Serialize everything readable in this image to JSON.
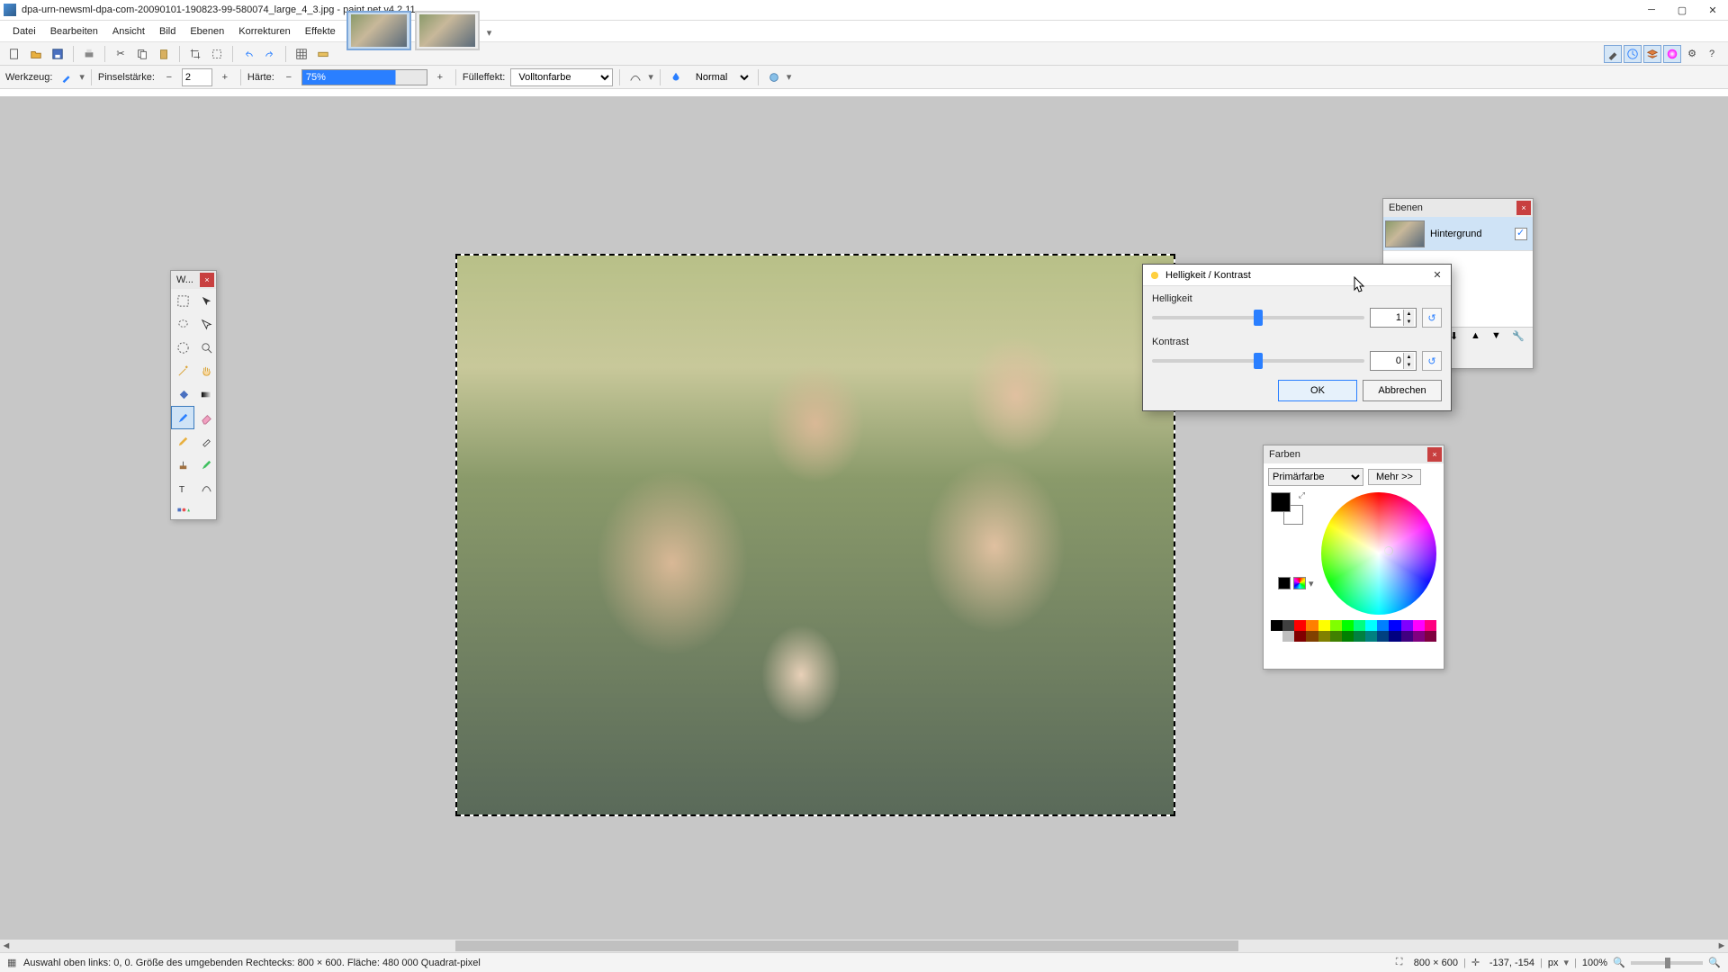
{
  "titlebar": {
    "title": "dpa-urn-newsml-dpa-com-20090101-190823-99-580074_large_4_3.jpg - paint.net v4.2.11"
  },
  "menu": {
    "items": [
      "Datei",
      "Bearbeiten",
      "Ansicht",
      "Bild",
      "Ebenen",
      "Korrekturen",
      "Effekte"
    ]
  },
  "toolbar2": {
    "tool_label": "Werkzeug:",
    "brush_label": "Pinselstärke:",
    "brush_value": "2",
    "hardness_label": "Härte:",
    "hardness_value": "75%",
    "fill_label": "Fülleffekt:",
    "fill_value": "Volltonfarbe",
    "blend_value": "Normal"
  },
  "tools_panel": {
    "title": "W..."
  },
  "layers_panel": {
    "title": "Ebenen",
    "layer0": "Hintergrund"
  },
  "colors_panel": {
    "title": "Farben",
    "mode": "Primärfarbe",
    "more": "Mehr >>"
  },
  "bc_dialog": {
    "title": "Helligkeit / Kontrast",
    "brightness_label": "Helligkeit",
    "brightness_value": "1",
    "contrast_label": "Kontrast",
    "contrast_value": "0",
    "ok": "OK",
    "cancel": "Abbrechen"
  },
  "status": {
    "selection": "Auswahl oben links: 0, 0. Größe des umgebenden Rechtecks: 800 × 600. Fläche: 480 000 Quadrat-pixel",
    "imgsize": "800 × 600",
    "cursor": "-137, -154",
    "unit": "px",
    "zoom": "100%"
  }
}
